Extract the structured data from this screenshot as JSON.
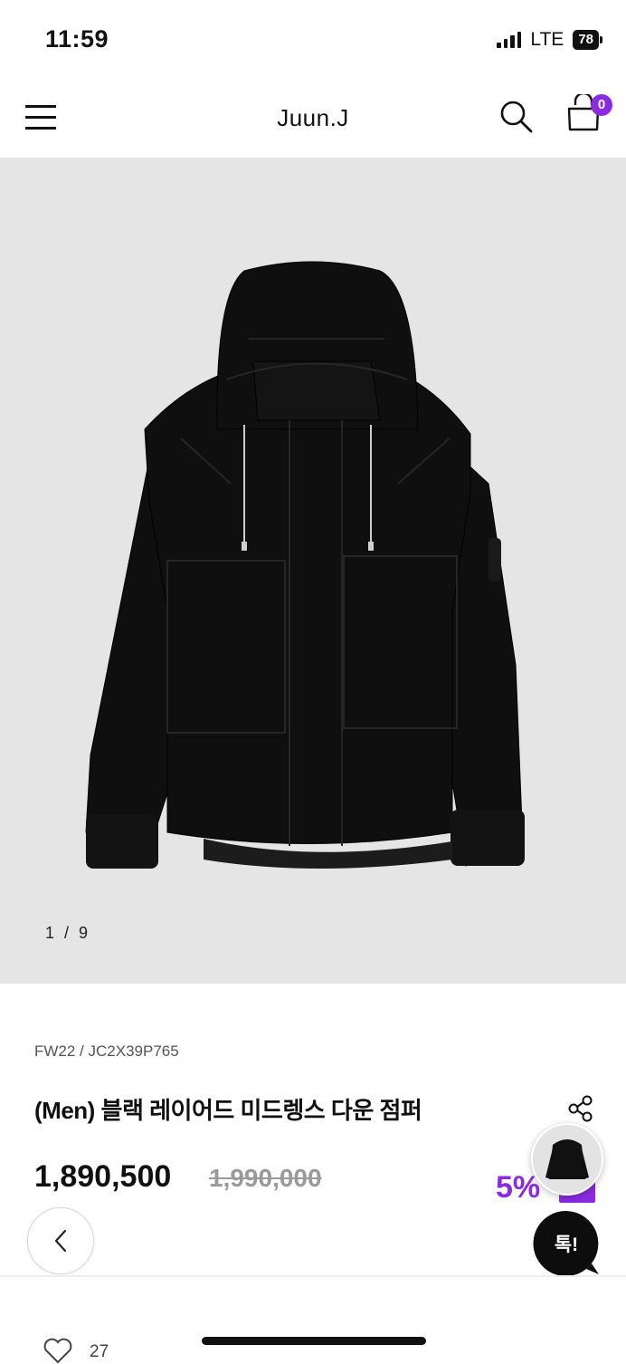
{
  "status_bar": {
    "time": "11:59",
    "network": "LTE",
    "battery": "78"
  },
  "header": {
    "brand": "Juun.J",
    "cart_count": "0"
  },
  "gallery": {
    "counter": "1 / 9"
  },
  "product": {
    "season_code": "FW22 / JC2X39P765",
    "title": "(Men) 블랙 레이어드 미드렝스 다운 점퍼",
    "price": "1,890,500",
    "original_price": "1,990,000",
    "discount": "5%"
  },
  "chat": {
    "label": "톡!"
  },
  "footer": {
    "like_count": "27"
  },
  "colors": {
    "accent": "#8a2be2",
    "image_bg": "#e5e5e5",
    "jacket": "#0e0e0e"
  }
}
